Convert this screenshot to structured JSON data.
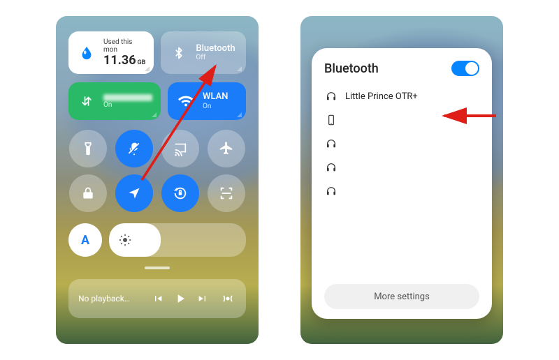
{
  "control_center": {
    "data_tile": {
      "header": "Used this mon",
      "value": "11.36",
      "unit": "GB"
    },
    "bluetooth_tile": {
      "title": "Bluetooth",
      "status": "Off"
    },
    "data_toggle": {
      "status": "On"
    },
    "wlan_tile": {
      "title": "WLAN",
      "status": "On"
    },
    "auto_brightness_label": "A",
    "media": {
      "label": "No playback…"
    }
  },
  "bluetooth_panel": {
    "title": "Bluetooth",
    "toggle_on": true,
    "devices": [
      {
        "type": "headphones",
        "name": "Little Prince OTR+",
        "blurred": false
      },
      {
        "type": "phone",
        "name": "",
        "blurred": true
      },
      {
        "type": "headphones",
        "name": "",
        "blurred": true
      },
      {
        "type": "headphones",
        "name": "",
        "blurred": true
      },
      {
        "type": "headphones",
        "name": "",
        "blurred": true
      }
    ],
    "more_settings": "More settings"
  },
  "colors": {
    "accent_blue": "#1f7bf2",
    "accent_green": "#2fb768",
    "annotation_red": "#d8201a"
  }
}
